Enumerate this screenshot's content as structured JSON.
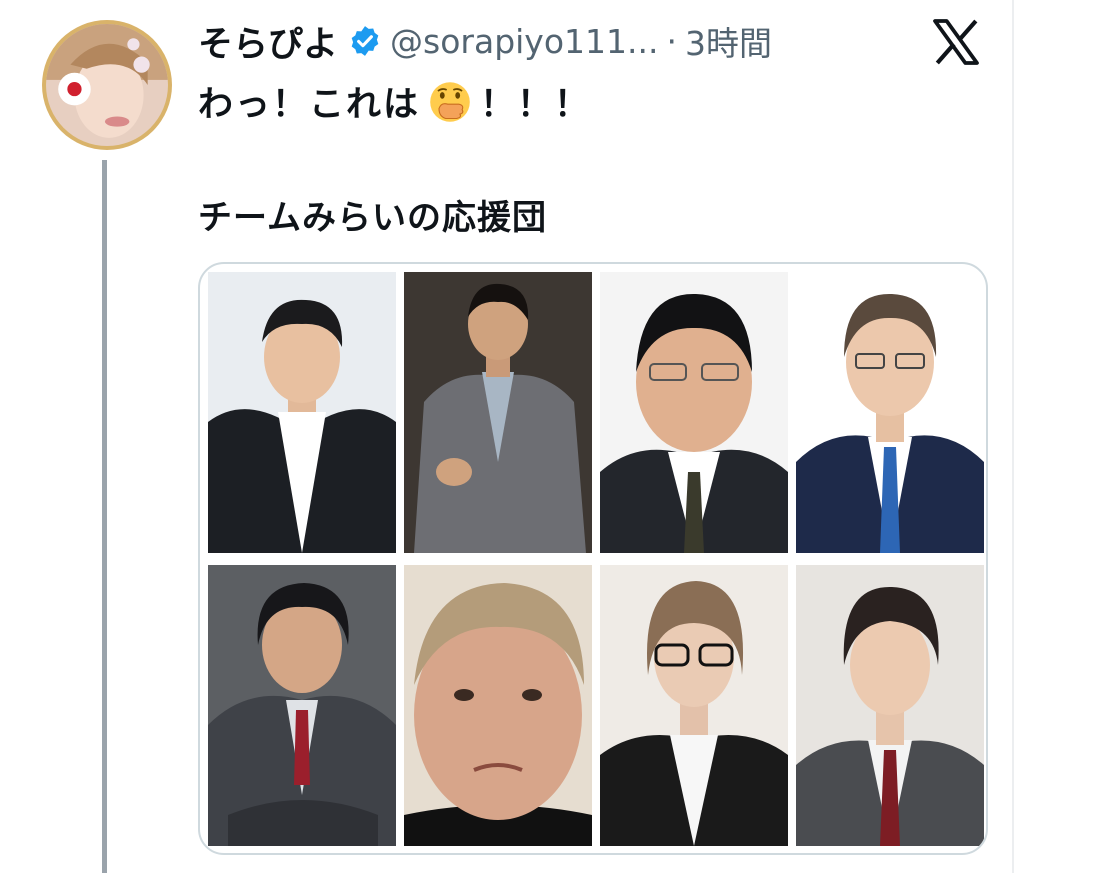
{
  "tweet": {
    "display_name": "そらぴよ",
    "handle": "@sorapiyo111...",
    "separator": "·",
    "time": "3時間",
    "text_before": "わっ！これは",
    "text_after": "！！！",
    "emoji": "face-with-hand-over-mouth"
  },
  "quote": {
    "title": "チームみらいの応援団"
  },
  "colors": {
    "verified": "#1d9bf0",
    "thread_line": "#9aa3ab",
    "secondary_text": "#536471",
    "card_border": "#cfd9de"
  },
  "icons": {
    "verified": "verified-badge-icon",
    "platform": "x-logo-icon"
  }
}
